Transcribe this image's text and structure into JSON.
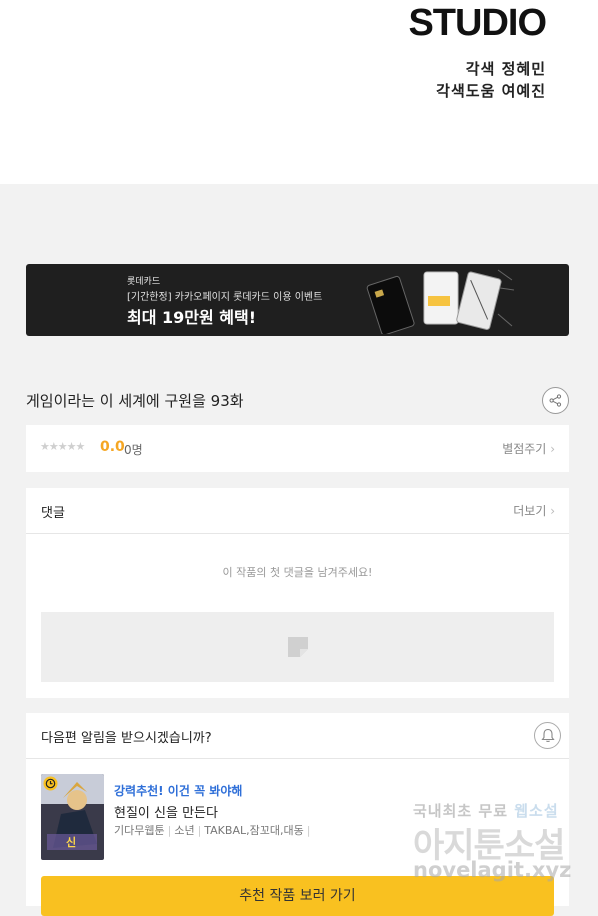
{
  "header": {
    "logo_text": "STUDIO",
    "credits": [
      "각색 정혜민",
      "각색도움 여예진"
    ]
  },
  "banner": {
    "brand": "롯데카드",
    "subtitle": "[기간한정] 카카오페이지 롯데카드 이용 이벤트",
    "headline": "최대 19만원 혜택!"
  },
  "episode": {
    "title": "게임이라는 이 세계에 구원을 93화"
  },
  "rating": {
    "stars": "★★★★★",
    "score": "0.0",
    "count": "0명",
    "rate_link": "별점주기"
  },
  "comments": {
    "title": "댓글",
    "more_link": "더보기",
    "empty_message": "이 작품의 첫 댓글을 남겨주세요!"
  },
  "notify": {
    "title": "다음편 알림을 받으시겠습니까?",
    "recommend_tag": "강력추천! 이건 꼭 봐야해",
    "recommend_title": "현질이 신을 만든다",
    "recommend_meta": [
      "기다무웹툰",
      "소년",
      "TAKBAL,잠꼬대,대동"
    ],
    "cta_label": "추천 작품 보러 가기"
  },
  "watermark": {
    "line1_prefix": "국내최초 무료 ",
    "line1_highlight": "웹소설",
    "line2": "아지툰소설",
    "line3": "novelagit.xyz"
  },
  "colors": {
    "accent_yellow": "#f9c120",
    "score_orange": "#f5a623",
    "tag_blue": "#2f6fd8",
    "banner_bg": "#1f1f1f"
  },
  "icons": [
    "share-icon",
    "chevron-right-icon",
    "image-placeholder-icon",
    "bell-icon",
    "clock-badge-icon"
  ]
}
